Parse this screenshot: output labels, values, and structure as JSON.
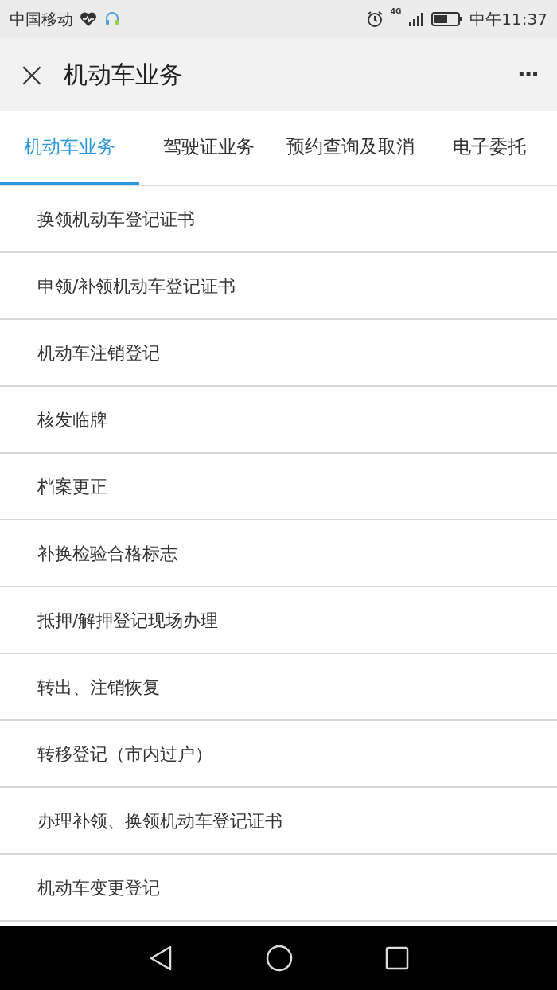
{
  "status_bar": {
    "carrier": "中国移动",
    "network": "4G",
    "time": "中午11:37"
  },
  "header": {
    "close": "×",
    "title": "机动车业务",
    "more": "···"
  },
  "tabs": [
    {
      "label": "机动车业务",
      "selected": true
    },
    {
      "label": "驾驶证业务",
      "selected": false
    },
    {
      "label": "预约查询及取消",
      "selected": false
    },
    {
      "label": "电子委托",
      "selected": false
    }
  ],
  "items": [
    "换领机动车登记证书",
    "申领/补领机动车登记证书",
    "机动车注销登记",
    "核发临牌",
    "档案更正",
    "补换检验合格标志",
    "抵押/解押登记现场办理",
    "转出、注销恢复",
    "转移登记（市内过户）",
    "办理补领、换领机动车登记证书",
    "机动车变更登记"
  ]
}
